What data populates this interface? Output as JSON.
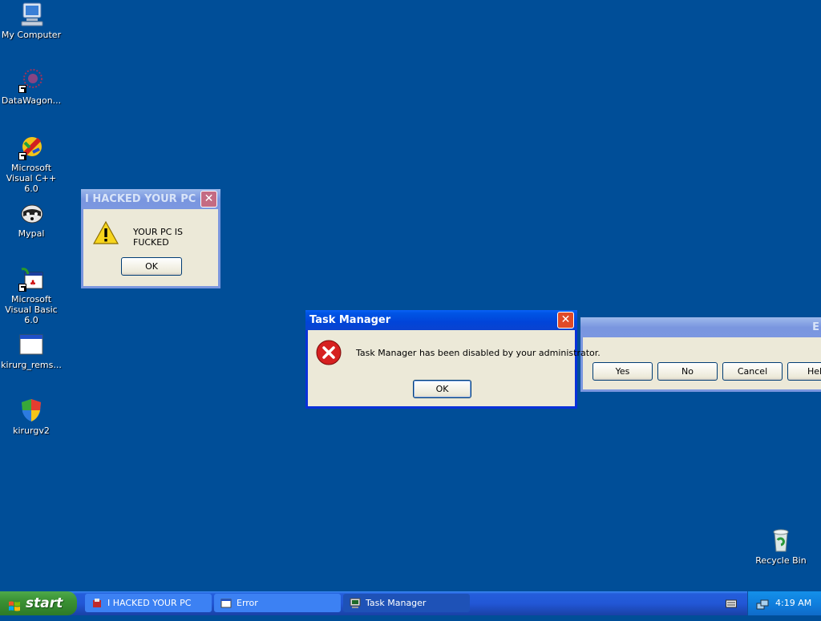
{
  "desktop": {
    "background_color": "#004e98",
    "icons": [
      {
        "label": "My Computer",
        "icon": "my-computer-icon"
      },
      {
        "label": "DataWagon...",
        "icon": "datawagon-icon"
      },
      {
        "label": "Microsoft Visual C++ 6.0",
        "icon": "visual-cpp-icon"
      },
      {
        "label": "Mypal",
        "icon": "mypal-icon"
      },
      {
        "label": "Microsoft Visual Basic 6.0",
        "icon": "visual-basic-icon"
      },
      {
        "label": "kirurg_rems...",
        "icon": "program-window-icon"
      },
      {
        "label": "kirurgv2",
        "icon": "shield-icon"
      },
      {
        "label": "Recycle Bin",
        "icon": "recycle-bin-icon"
      }
    ]
  },
  "dialog_hacked": {
    "title": "I HACKED YOUR PC",
    "message": "YOUR PC IS FUCKED",
    "ok_label": "OK",
    "icon": "warning-icon"
  },
  "dialog_taskmgr": {
    "title": "Task Manager",
    "message": "Task Manager has been disabled by your administrator.",
    "ok_label": "OK",
    "icon": "error-icon"
  },
  "dialog_error": {
    "title_visible": "E",
    "buttons": [
      "Yes",
      "No",
      "Cancel",
      "Hel"
    ]
  },
  "taskbar": {
    "start_label": "start",
    "tasks": [
      {
        "label": "I HACKED YOUR PC",
        "icon": "app-icon",
        "pressed": false
      },
      {
        "label": "Error",
        "icon": "window-icon",
        "pressed": false
      },
      {
        "label": "Task Manager",
        "icon": "task-manager-icon",
        "pressed": true
      }
    ],
    "clock": "4:19 AM"
  },
  "colors": {
    "xp_blue_title": "#0055e5",
    "start_green": "#3a9133",
    "dialog_face": "#ece9d8",
    "close_red": "#e04a28"
  }
}
